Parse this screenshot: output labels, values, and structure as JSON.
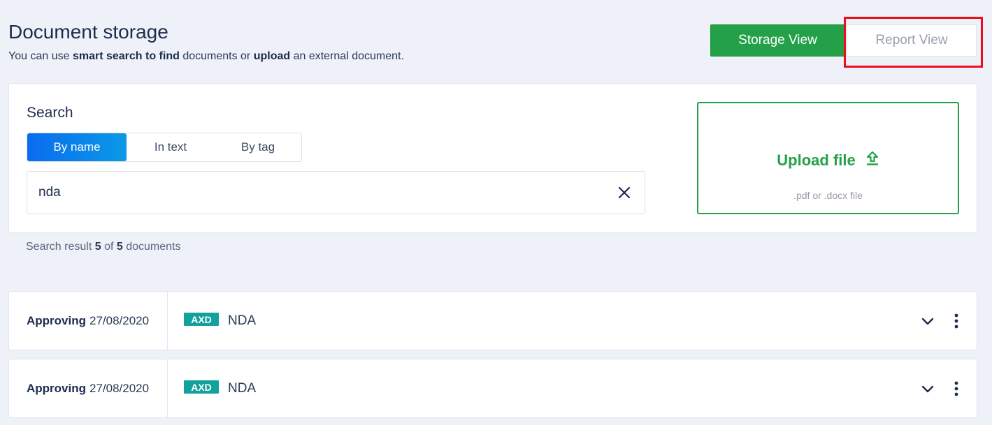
{
  "header": {
    "title": "Document storage",
    "subtitle": {
      "p1": "You can use ",
      "b1": "smart search to find",
      "p2": " documents or ",
      "b2": "upload",
      "p3": " an external document."
    }
  },
  "view_toggle": {
    "storage_label": "Storage View",
    "report_label": "Report View"
  },
  "search": {
    "label": "Search",
    "tabs": [
      "By name",
      "In text",
      "By tag"
    ],
    "active_tab": "By name",
    "value": "nda"
  },
  "upload": {
    "label": "Upload file",
    "hint": ".pdf or .docx file"
  },
  "results": {
    "prefix": "Search result ",
    "shown": "5",
    "of": " of ",
    "total": "5",
    "suffix": " documents"
  },
  "documents": [
    {
      "status": "Approving",
      "date": "27/08/2020",
      "tag": "AXD",
      "name": "NDA"
    },
    {
      "status": "Approving",
      "date": "27/08/2020",
      "tag": "AXD",
      "name": "NDA"
    }
  ],
  "colors": {
    "accent_green": "#24a148",
    "tab_active_blue": "#0a6cf0",
    "tag_teal": "#13a19e",
    "highlight_red": "#ee0d1a"
  },
  "icons": {
    "clear": "close-icon",
    "upload": "upload-icon",
    "expand": "chevron-down-icon",
    "more": "more-vertical-icon"
  }
}
